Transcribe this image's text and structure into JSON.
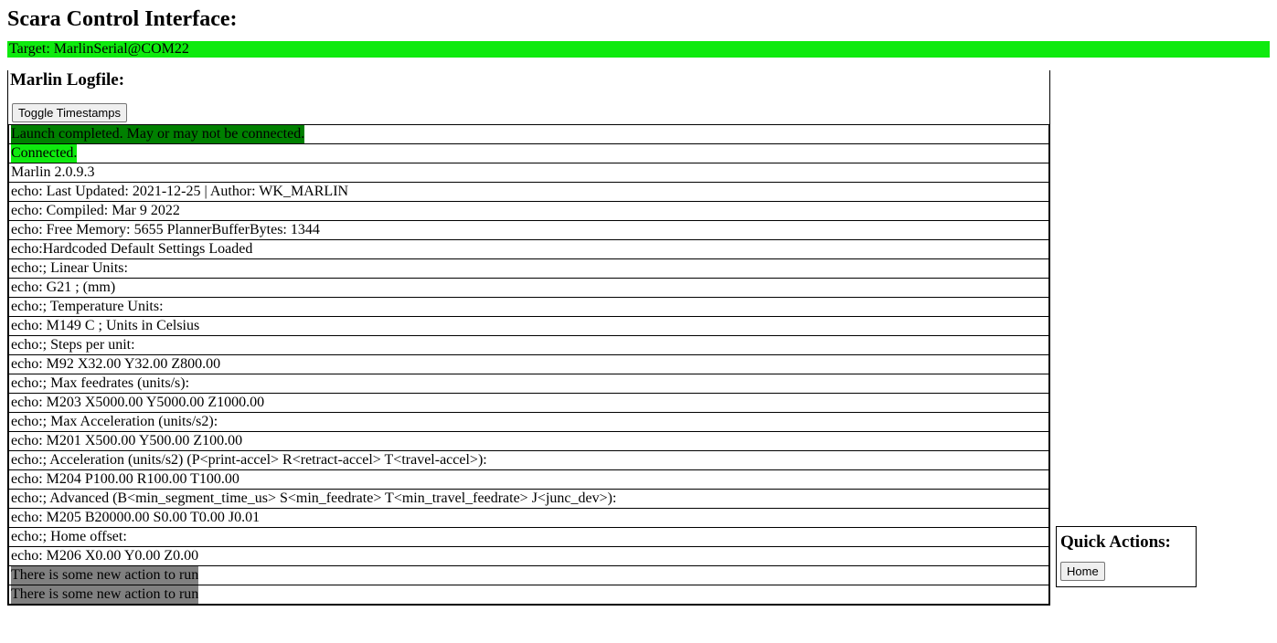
{
  "page": {
    "title": "Scara Control Interface:"
  },
  "target": {
    "label": "Target: MarlinSerial@COM22"
  },
  "logfile": {
    "heading": "Marlin Logfile:",
    "toggle_button": "Toggle Timestamps",
    "entries": [
      {
        "text": "Launch completed. May or may not be connected.",
        "style": "launch"
      },
      {
        "text": "Connected.",
        "style": "connected"
      },
      {
        "text": "Marlin 2.0.9.3",
        "style": "normal"
      },
      {
        "text": "echo: Last Updated: 2021-12-25 | Author: WK_MARLIN",
        "style": "normal"
      },
      {
        "text": "echo: Compiled: Mar 9 2022",
        "style": "normal"
      },
      {
        "text": "echo: Free Memory: 5655 PlannerBufferBytes: 1344",
        "style": "normal"
      },
      {
        "text": "echo:Hardcoded Default Settings Loaded",
        "style": "normal"
      },
      {
        "text": "echo:; Linear Units:",
        "style": "normal"
      },
      {
        "text": "echo: G21 ; (mm)",
        "style": "normal"
      },
      {
        "text": "echo:; Temperature Units:",
        "style": "normal"
      },
      {
        "text": "echo: M149 C ; Units in Celsius",
        "style": "normal"
      },
      {
        "text": "echo:; Steps per unit:",
        "style": "normal"
      },
      {
        "text": "echo: M92 X32.00 Y32.00 Z800.00",
        "style": "normal"
      },
      {
        "text": "echo:; Max feedrates (units/s):",
        "style": "normal"
      },
      {
        "text": "echo: M203 X5000.00 Y5000.00 Z1000.00",
        "style": "normal"
      },
      {
        "text": "echo:; Max Acceleration (units/s2):",
        "style": "normal"
      },
      {
        "text": "echo: M201 X500.00 Y500.00 Z100.00",
        "style": "normal"
      },
      {
        "text": "echo:; Acceleration (units/s2) (P<print-accel> R<retract-accel> T<travel-accel>):",
        "style": "normal"
      },
      {
        "text": "echo: M204 P100.00 R100.00 T100.00",
        "style": "normal"
      },
      {
        "text": "echo:; Advanced (B<min_segment_time_us> S<min_feedrate> T<min_travel_feedrate> J<junc_dev>):",
        "style": "normal"
      },
      {
        "text": "echo: M205 B20000.00 S0.00 T0.00 J0.01",
        "style": "normal"
      },
      {
        "text": "echo:; Home offset:",
        "style": "normal"
      },
      {
        "text": "echo: M206 X0.00 Y0.00 Z0.00",
        "style": "normal"
      },
      {
        "text": "There is some new action to run",
        "style": "action"
      },
      {
        "text": "There is some new action to run",
        "style": "action"
      }
    ]
  },
  "quick_actions": {
    "heading": "Quick Actions:",
    "home_button": "Home"
  }
}
